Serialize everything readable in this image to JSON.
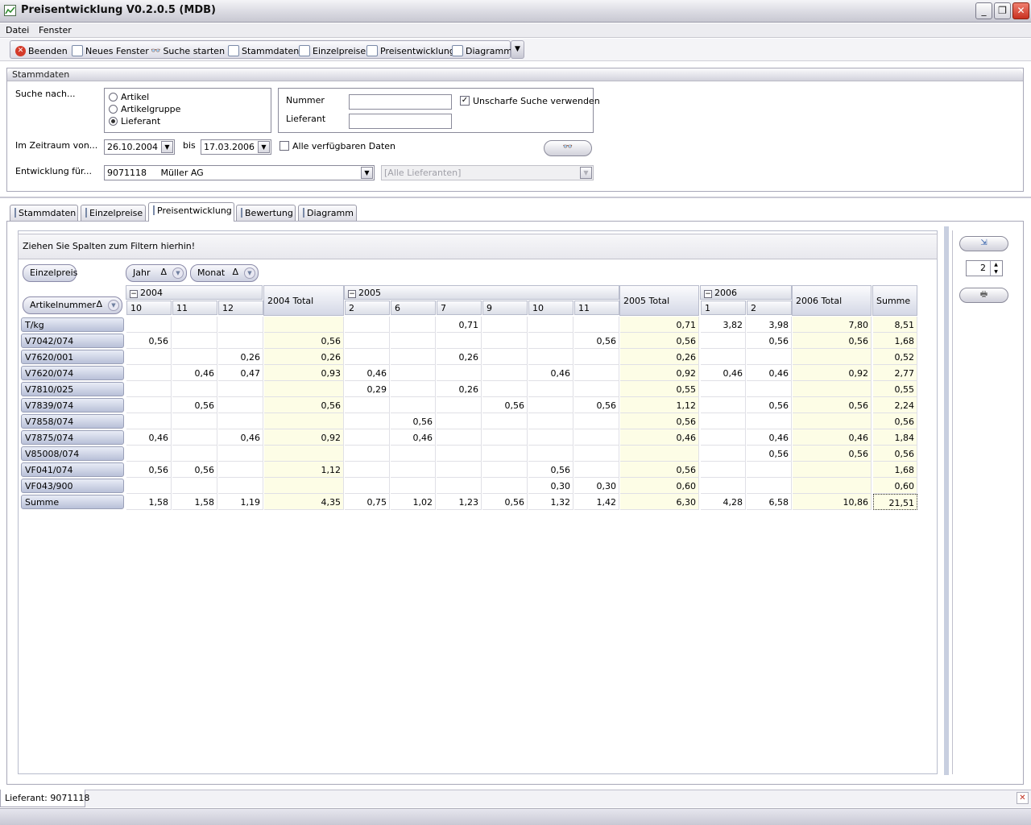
{
  "window": {
    "title": "Preisentwicklung V0.2.0.5 (MDB)"
  },
  "menu": [
    "Datei",
    "Fenster"
  ],
  "toolbar": [
    "Beenden",
    "Neues Fenster",
    "Suche starten",
    "Stammdaten",
    "Einzelpreise",
    "Preisentwicklung",
    "Diagramm"
  ],
  "stammdaten": {
    "header": "Stammdaten",
    "suche_label": "Suche nach...",
    "radios": [
      {
        "label": "Artikel",
        "checked": false
      },
      {
        "label": "Artikelgruppe",
        "checked": false
      },
      {
        "label": "Lieferant",
        "checked": true
      }
    ],
    "nummer_label": "Nummer",
    "nummer_value": "",
    "lieferant_label": "Lieferant",
    "lieferant_value": "",
    "unscharf_label": "Unscharfe Suche verwenden",
    "unscharf_checked": true,
    "zeitraum_label": "Im Zeitraum von...",
    "date_from": "26.10.2004",
    "bis_label": "bis",
    "date_to": "17.03.2006",
    "alle_daten_label": "Alle verfügbaren Daten",
    "alle_daten_checked": false,
    "entwicklung_label": "Entwicklung für...",
    "entwicklung_value": "9071118     Müller AG",
    "lieferanten_placeholder": "[Alle Lieferanten]"
  },
  "tabs": [
    {
      "label": "Stammdaten",
      "active": false
    },
    {
      "label": "Einzelpreise",
      "active": false
    },
    {
      "label": "Preisentwicklung",
      "active": true
    },
    {
      "label": "Bewertung",
      "active": false
    },
    {
      "label": "Diagramm",
      "active": false
    }
  ],
  "pivot": {
    "filter_hint": "Ziehen Sie Spalten zum Filtern hierhin!",
    "data_field": "Einzelpreis",
    "col_fields": [
      {
        "label": "Jahr",
        "sort": "Δ"
      },
      {
        "label": "Monat",
        "sort": "Δ"
      }
    ],
    "row_field": {
      "label": "Artikelnummer",
      "sort": "Δ"
    },
    "years": [
      {
        "label": "2004",
        "months": [
          "10",
          "11",
          "12"
        ],
        "total": "2004 Total"
      },
      {
        "label": "2005",
        "months": [
          "2",
          "6",
          "7",
          "9",
          "10",
          "11"
        ],
        "total": "2005 Total"
      },
      {
        "label": "2006",
        "months": [
          "1",
          "2"
        ],
        "total": "2006 Total"
      }
    ],
    "grand_total_label": "Summe",
    "rows": [
      {
        "label": "T/kg",
        "cells": [
          "",
          "",
          "",
          "",
          "",
          "",
          "0,71",
          "",
          "",
          "",
          "0,71",
          "3,82",
          "3,98",
          "7,80",
          "8,51"
        ]
      },
      {
        "label": "V7042/074",
        "cells": [
          "0,56",
          "",
          "",
          "0,56",
          "",
          "",
          "",
          "",
          "",
          "0,56",
          "0,56",
          "",
          "0,56",
          "0,56",
          "1,68"
        ]
      },
      {
        "label": "V7620/001",
        "cells": [
          "",
          "",
          "0,26",
          "0,26",
          "",
          "",
          "0,26",
          "",
          "",
          "",
          "0,26",
          "",
          "",
          "",
          "0,52"
        ]
      },
      {
        "label": "V7620/074",
        "cells": [
          "",
          "0,46",
          "0,47",
          "0,93",
          "0,46",
          "",
          "",
          "",
          "0,46",
          "",
          "0,92",
          "0,46",
          "0,46",
          "0,92",
          "2,77"
        ]
      },
      {
        "label": "V7810/025",
        "cells": [
          "",
          "",
          "",
          "",
          "0,29",
          "",
          "0,26",
          "",
          "",
          "",
          "0,55",
          "",
          "",
          "",
          "0,55"
        ]
      },
      {
        "label": "V7839/074",
        "cells": [
          "",
          "0,56",
          "",
          "0,56",
          "",
          "",
          "",
          "0,56",
          "",
          "0,56",
          "1,12",
          "",
          "0,56",
          "0,56",
          "2,24"
        ]
      },
      {
        "label": "V7858/074",
        "cells": [
          "",
          "",
          "",
          "",
          "",
          "0,56",
          "",
          "",
          "",
          "",
          "0,56",
          "",
          "",
          "",
          "0,56"
        ]
      },
      {
        "label": "V7875/074",
        "cells": [
          "0,46",
          "",
          "0,46",
          "0,92",
          "",
          "0,46",
          "",
          "",
          "",
          "",
          "0,46",
          "",
          "0,46",
          "0,46",
          "1,84"
        ]
      },
      {
        "label": "V85008/074",
        "cells": [
          "",
          "",
          "",
          "",
          "",
          "",
          "",
          "",
          "",
          "",
          "",
          "",
          "0,56",
          "0,56",
          "0,56"
        ]
      },
      {
        "label": "VF041/074",
        "cells": [
          "0,56",
          "0,56",
          "",
          "1,12",
          "",
          "",
          "",
          "",
          "0,56",
          "",
          "0,56",
          "",
          "",
          "",
          "1,68"
        ]
      },
      {
        "label": "VF043/900",
        "cells": [
          "",
          "",
          "",
          "",
          "",
          "",
          "",
          "",
          "0,30",
          "0,30",
          "0,60",
          "",
          "",
          "",
          "0,60"
        ]
      },
      {
        "label": "Summe",
        "cells": [
          "1,58",
          "1,58",
          "1,19",
          "4,35",
          "0,75",
          "1,02",
          "1,23",
          "0,56",
          "1,32",
          "1,42",
          "6,30",
          "4,28",
          "6,58",
          "10,86",
          "21,51"
        ]
      }
    ]
  },
  "side": {
    "spin_value": "2"
  },
  "status": {
    "text": "Lieferant: 9071118"
  }
}
